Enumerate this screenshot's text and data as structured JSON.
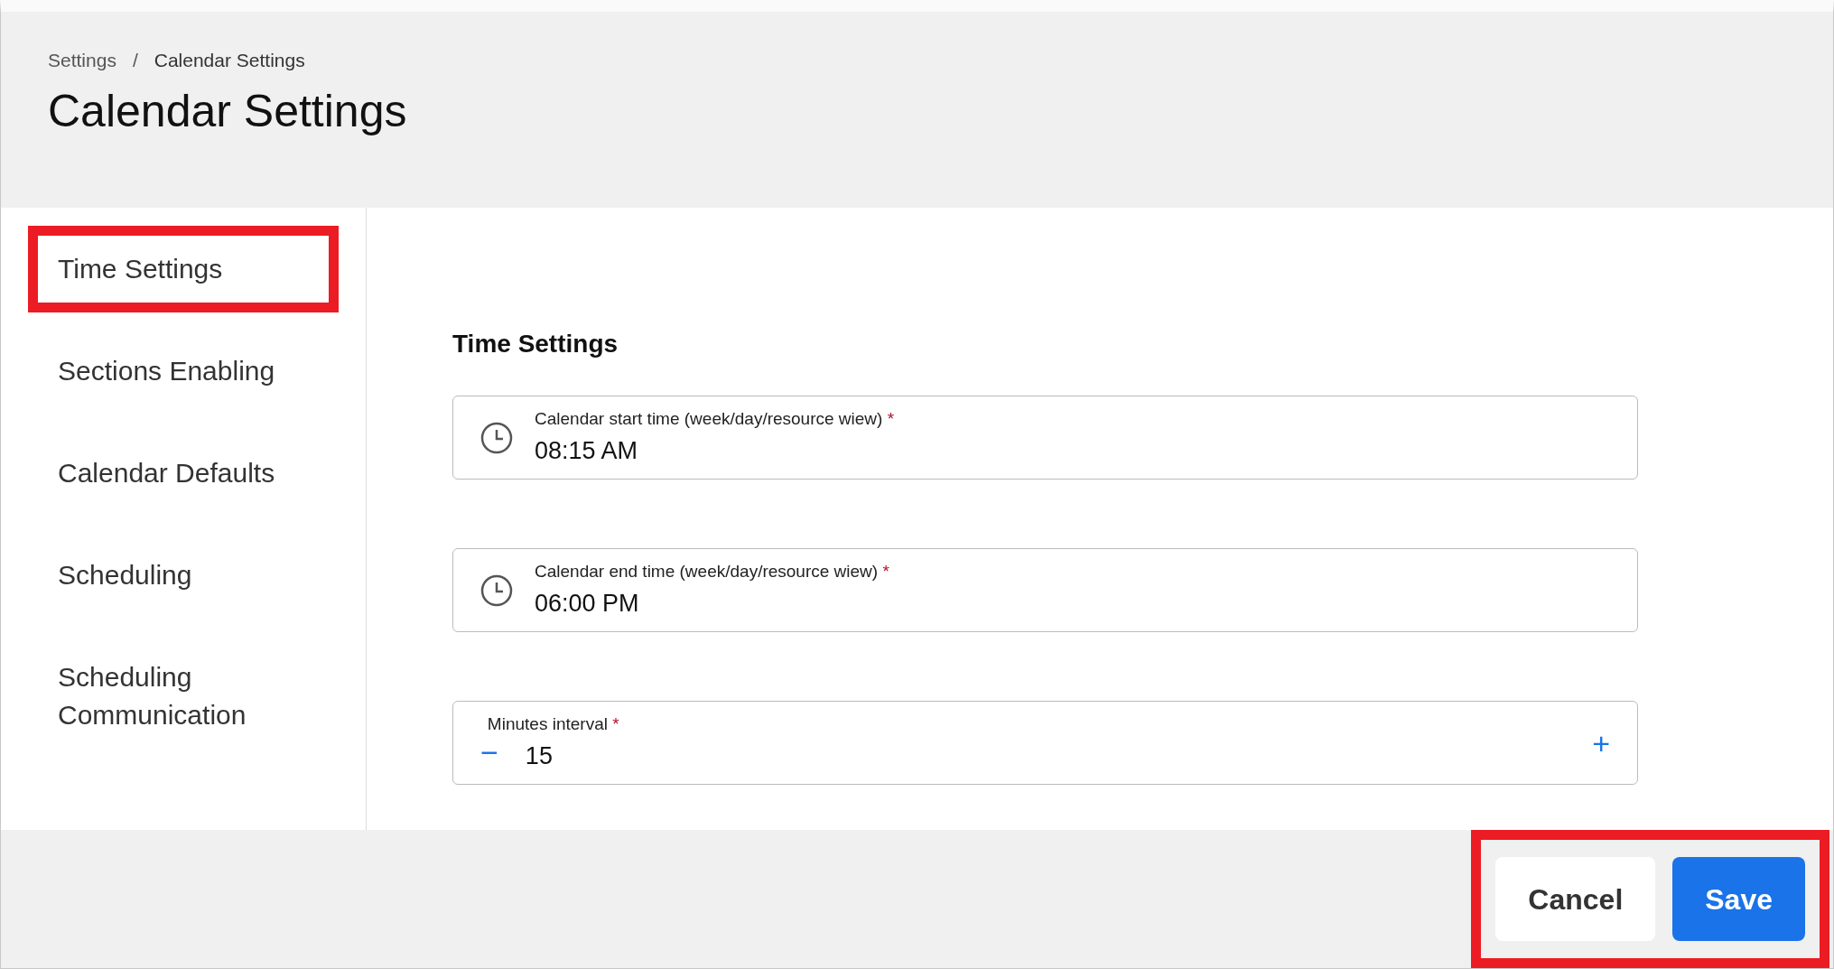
{
  "breadcrumb": [
    {
      "label": "Settings",
      "current": false
    },
    {
      "label": "Calendar Settings",
      "current": true
    }
  ],
  "breadcrumb_separator": "/",
  "required_mark": "*",
  "page_title": "Calendar Settings",
  "sidebar": {
    "items": [
      {
        "label": "Time Settings",
        "highlighted": true
      },
      {
        "label": "Sections Enabling",
        "highlighted": false
      },
      {
        "label": "Calendar Defaults",
        "highlighted": false
      },
      {
        "label": "Scheduling",
        "highlighted": false
      },
      {
        "label": "Scheduling Communication",
        "highlighted": false
      }
    ]
  },
  "section_title": "Time Settings",
  "fields": [
    {
      "kind": "time",
      "label": "Calendar start time (week/day/resource wiew)",
      "required": true,
      "value": "08:15 AM"
    },
    {
      "kind": "time",
      "label": "Calendar end time (week/day/resource wiew)",
      "required": true,
      "value": "06:00 PM"
    },
    {
      "kind": "stepper",
      "label": "Minutes interval",
      "required": true,
      "value": "15",
      "decrement": "−",
      "increment": "+"
    }
  ],
  "footer": {
    "highlighted": true,
    "buttons": [
      {
        "kind": "secondary",
        "label": "Cancel"
      },
      {
        "kind": "primary",
        "label": "Save"
      }
    ]
  }
}
